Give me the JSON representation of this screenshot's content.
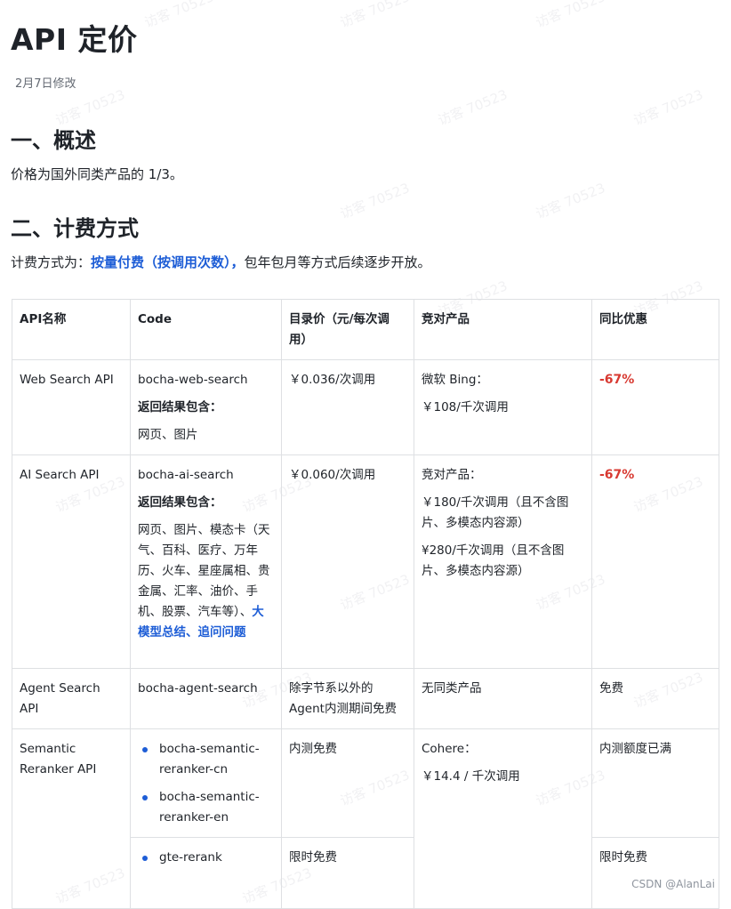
{
  "doc": {
    "title": "API 定价",
    "modified": "2月7日修改",
    "section1": "一、概述",
    "section1_text": "价格为国外同类产品的 1/3。",
    "section2": "二、计费方式",
    "billing_prefix": "计费方式为：",
    "billing_link": "按量付费（按调用次数），",
    "billing_suffix": "包年包月等方式后续逐步开放。"
  },
  "table": {
    "headers": [
      "API名称",
      "Code",
      "目录价（元/每次调用）",
      "竞对产品",
      "同比优惠"
    ],
    "rows": [
      {
        "name": "Web Search API",
        "code": "bocha-web-search",
        "includes_label": "返回结果包含：",
        "includes": "网页、图片",
        "price": "￥0.036/次调用",
        "competitor_lines": [
          "微软 Bing：",
          "￥108/千次调用"
        ],
        "discount": "-67%"
      },
      {
        "name": "AI Search API",
        "code": "bocha-ai-search",
        "includes_label": "返回结果包含：",
        "includes": "网页、图片、模态卡（天气、百科、医疗、万年历、火车、星座属相、贵金属、汇率、油价、手机、股票、汽车等）、",
        "includes_link": "大模型总结、追问问题",
        "price": "￥0.060/次调用",
        "competitor_lines": [
          "竞对产品：",
          "￥180/千次调用（且不含图片、多模态内容源）",
          "¥280/千次调用（且不含图片、多模态内容源）"
        ],
        "discount": "-67%"
      },
      {
        "name": "Agent Search API",
        "code": "bocha-agent-search",
        "price": "除字节系以外的Agent内测期间免费",
        "competitor": "无同类产品",
        "discount": "免费"
      },
      {
        "name": "Semantic Reranker API",
        "codes_a": [
          "bocha-semantic-reranker-cn",
          "bocha-semantic-reranker-en"
        ],
        "price_a": "内测免费",
        "competitor_lines": [
          "Cohere：",
          "￥14.4 / 千次调用"
        ],
        "discount_a": "内测额度已满",
        "codes_b": [
          "gte-rerank"
        ],
        "price_b": "限时免费",
        "discount_b": "限时免费"
      }
    ]
  },
  "footer": "CSDN @AlanLai",
  "watermark": "访客 70523",
  "colors": {
    "accent": "#1d5dd6",
    "discount_red": "#d83931",
    "border": "#dee0e3"
  }
}
